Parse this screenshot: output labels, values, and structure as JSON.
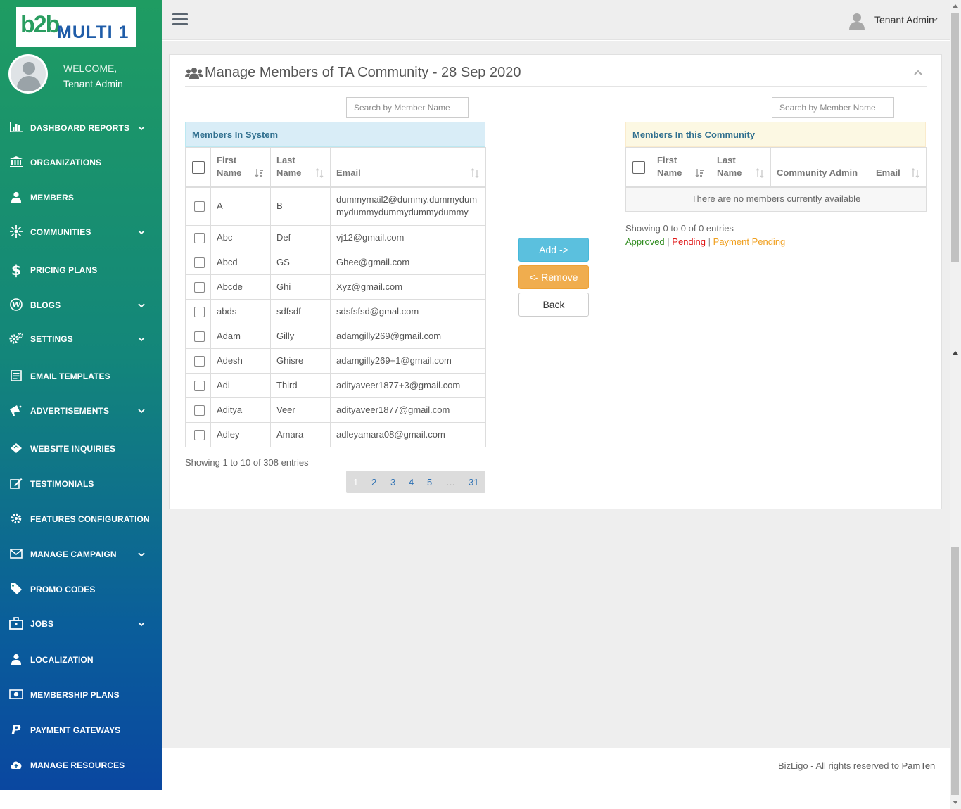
{
  "brand": {
    "mark": "b2b",
    "name": "MULTI 1"
  },
  "welcome": {
    "greeting": "WELCOME,",
    "user": "Tenant Admin"
  },
  "sidebar": {
    "items": [
      {
        "label": "DASHBOARD REPORTS",
        "icon": "bar-chart-icon",
        "chevron": true
      },
      {
        "label": "ORGANIZATIONS",
        "icon": "bank-icon",
        "chevron": false
      },
      {
        "label": "MEMBERS",
        "icon": "user-icon",
        "chevron": false
      },
      {
        "label": "COMMUNITIES",
        "icon": "network-icon",
        "chevron": true
      },
      {
        "label": "PRICING PLANS",
        "icon": "dollar-icon",
        "chevron": false
      },
      {
        "label": "BLOGS",
        "icon": "wordpress-icon",
        "chevron": true
      },
      {
        "label": "SETTINGS",
        "icon": "cogs-icon",
        "chevron": true
      },
      {
        "label": "EMAIL TEMPLATES",
        "icon": "template-icon",
        "chevron": false
      },
      {
        "label": "ADVERTISEMENTS",
        "icon": "bullhorn-icon",
        "chevron": true
      },
      {
        "label": "WEBSITE INQUIRIES",
        "icon": "ticket-icon",
        "chevron": false
      },
      {
        "label": "TESTIMONIALS",
        "icon": "edit-icon",
        "chevron": false
      },
      {
        "label": "FEATURES CONFIGURATION",
        "icon": "gear-icon",
        "chevron": false
      },
      {
        "label": "MANAGE CAMPAIGN",
        "icon": "envelope-icon",
        "chevron": true
      },
      {
        "label": "PROMO CODES",
        "icon": "tag-icon",
        "chevron": false
      },
      {
        "label": "JOBS",
        "icon": "briefcase-icon",
        "chevron": true
      },
      {
        "label": "LOCALIZATION",
        "icon": "user-icon",
        "chevron": false
      },
      {
        "label": "MEMBERSHIP PLANS",
        "icon": "money-icon",
        "chevron": false
      },
      {
        "label": "PAYMENT GATEWAYS",
        "icon": "paypal-icon",
        "chevron": false
      },
      {
        "label": "MANAGE RESOURCES",
        "icon": "cloud-upload-icon",
        "chevron": false
      }
    ]
  },
  "topbar": {
    "user": "Tenant Admin"
  },
  "panel": {
    "title": "Manage Members of TA Community - 28 Sep 2020"
  },
  "left_table": {
    "search_placeholder": "Search by Member Name",
    "title": "Members In System",
    "headers": {
      "first": "First Name",
      "first_l1": "First",
      "first_l2": "Name",
      "last_l1": "Last",
      "last_l2": "Name",
      "email": "Email"
    },
    "rows": [
      {
        "first": "A",
        "last": "B",
        "email": "dummymail2@dummy.dummydummydummydummydummydummy"
      },
      {
        "first": "Abc",
        "last": "Def",
        "email": "vj12@gmail.com"
      },
      {
        "first": "Abcd",
        "last": "GS",
        "email": "Ghee@gmail.com"
      },
      {
        "first": "Abcde",
        "last": "Ghi",
        "email": "Xyz@gmail.com"
      },
      {
        "first": "abds",
        "last": "sdfsdf",
        "email": "sdsfsfsd@gmal.com"
      },
      {
        "first": "Adam",
        "last": "Gilly",
        "email": "adamgilly269@gmail.com"
      },
      {
        "first": "Adesh",
        "last": "Ghisre",
        "email": "adamgilly269+1@gmail.com"
      },
      {
        "first": "Adi",
        "last": "Third",
        "email": "adityaveer1877+3@gmail.com"
      },
      {
        "first": "Aditya",
        "last": "Veer",
        "email": "adityaveer1877@gmail.com"
      },
      {
        "first": "Adley",
        "last": "Amara",
        "email": "adleyamara08@gmail.com"
      }
    ],
    "info": "Showing 1 to 10 of 308 entries",
    "pages": [
      "1",
      "2",
      "3",
      "4",
      "5",
      "…",
      "31"
    ]
  },
  "actions": {
    "add": "Add ->",
    "remove": "<- Remove",
    "back": "Back"
  },
  "right_table": {
    "search_placeholder": "Search by Member Name",
    "title": "Members In this Community",
    "headers": {
      "first_l1": "First",
      "first_l2": "Name",
      "last_l1": "Last",
      "last_l2": "Name",
      "admin": "Community Admin",
      "email": "Email"
    },
    "empty": "There are no members currently available",
    "info": "Showing 0 to 0 of 0 entries",
    "legend": {
      "approved": "Approved",
      "sep": "|",
      "pending": "Pending",
      "payment_pending": "Payment Pending"
    }
  },
  "footer": {
    "text": "BizLigo - All rights reserved to",
    "brand": "PamTen"
  },
  "colors": {
    "approved": "#2e8b1e",
    "pending": "#e01818",
    "payment_pending": "#f0a020",
    "left_header_bg": "#d9edf7",
    "right_header_bg": "#fcf8e3",
    "link": "#2a6fb3"
  }
}
